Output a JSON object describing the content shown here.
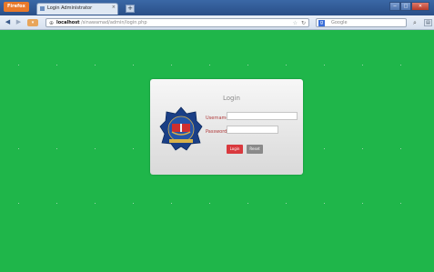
{
  "browser": {
    "menu_label": "Firefox",
    "tab_title": "Login Administrator",
    "tab_close": "×",
    "new_tab": "+",
    "url_host": "localhost",
    "url_path": "/sinawamad/admin/login.php",
    "search_placeholder": "Google",
    "search_engine_letter": "g",
    "window_buttons": [
      "−",
      "□",
      "✕"
    ]
  },
  "login": {
    "title": "Login",
    "username_label": "Username",
    "password_label": "Password",
    "username_value": "",
    "password_value": "",
    "login_button": "Login",
    "reset_button": "Reset"
  },
  "colors": {
    "page_background": "#1fb64a",
    "login_button": "#d9393e",
    "reset_button": "#8a8a8a"
  }
}
